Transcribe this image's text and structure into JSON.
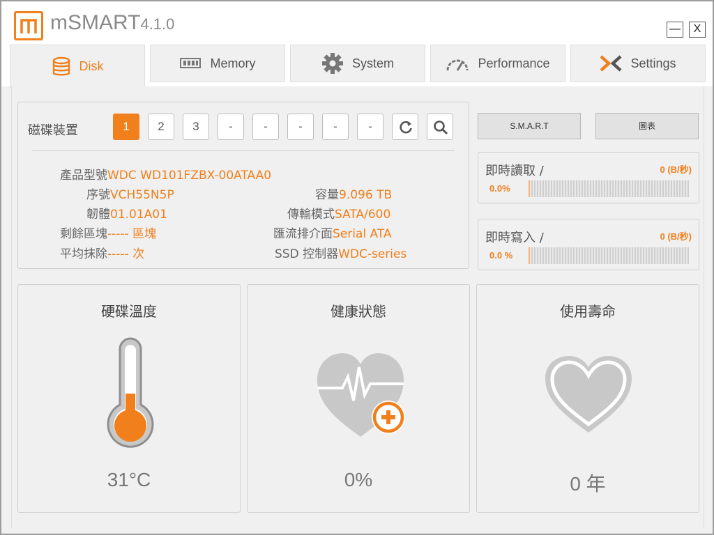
{
  "app": {
    "name": "mSMART",
    "version": "4.1.0"
  },
  "window_controls": {
    "minimize": "—",
    "close": "X"
  },
  "tabs": [
    {
      "label": "Disk",
      "icon": "database-icon",
      "active": true
    },
    {
      "label": "Memory",
      "icon": "memory-chip-icon",
      "active": false
    },
    {
      "label": "System",
      "icon": "gear-icon",
      "active": false
    },
    {
      "label": "Performance",
      "icon": "speedometer-icon",
      "active": false
    },
    {
      "label": "Settings",
      "icon": "settings-x-icon",
      "active": false
    }
  ],
  "device": {
    "label": "磁碟裝置",
    "buttons": [
      "1",
      "2",
      "3",
      "-",
      "-",
      "-",
      "-",
      "-"
    ],
    "selected": "1",
    "refresh_icon": "refresh-icon",
    "search_icon": "search-icon"
  },
  "info": {
    "model_key": "產品型號",
    "model_val": "WDC WD101FZBX-00ATAA0",
    "serial_key": "序號",
    "serial_val": "VCH55N5P",
    "firmware_key": "韌體",
    "firmware_val": "01.01A01",
    "remaining_key": "剩餘區塊",
    "remaining_val": "----- 區塊",
    "wear_key": "平均抹除",
    "wear_val": "----- 次",
    "capacity_key": "容量",
    "capacity_val": "9.096 TB",
    "transfer_key": "傳輸模式",
    "transfer_val": "SATA/600",
    "interface_key": "匯流排介面",
    "interface_val": "Serial ATA",
    "controller_key": "SSD 控制器",
    "controller_val": "WDC-series"
  },
  "side_buttons": {
    "smart": "S.M.A.R.T",
    "chart": "圖表"
  },
  "read": {
    "title": "即時讀取 /",
    "rate": "0 (B/秒)",
    "percent": "0.0%",
    "fraction": 0.0
  },
  "write": {
    "title": "即時寫入 /",
    "rate": "0 (B/秒)",
    "percent": "0.0 %",
    "fraction": 0.0
  },
  "cards": {
    "temperature": {
      "title": "硬碟溫度",
      "value": "31°C"
    },
    "health": {
      "title": "健康狀態",
      "value": "0%"
    },
    "lifespan": {
      "title": "使用壽命",
      "value": "0 年"
    }
  },
  "colors": {
    "accent": "#f07f1c",
    "icon_gray": "#8f8f8f",
    "art_gray": "#c8c8c8"
  }
}
